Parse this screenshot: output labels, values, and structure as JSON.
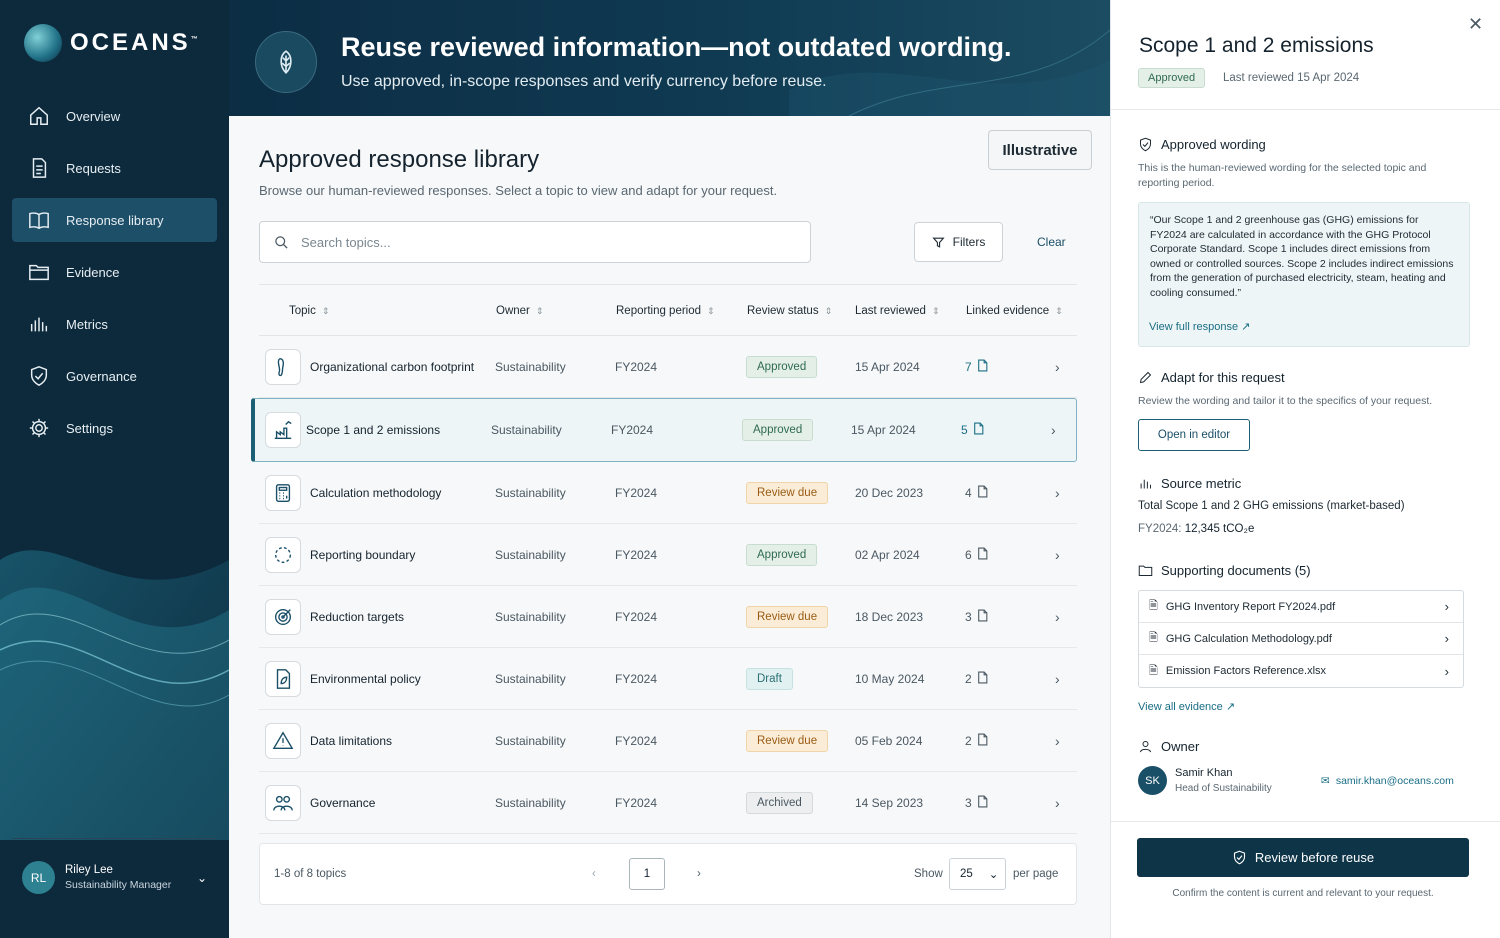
{
  "brand": {
    "name": "OCEANS",
    "tm": "™"
  },
  "nav": [
    {
      "label": "Overview",
      "icon": "home-icon",
      "active": false
    },
    {
      "label": "Requests",
      "icon": "document-icon",
      "active": false
    },
    {
      "label": "Response library",
      "icon": "book-icon",
      "active": true
    },
    {
      "label": "Evidence",
      "icon": "folder-icon",
      "active": false
    },
    {
      "label": "Metrics",
      "icon": "bar-chart-icon",
      "active": false
    },
    {
      "label": "Governance",
      "icon": "shield-icon",
      "active": false
    },
    {
      "label": "Settings",
      "icon": "gear-icon",
      "active": false
    }
  ],
  "user": {
    "initials": "RL",
    "name": "Riley Lee",
    "role": "Sustainability Manager"
  },
  "banner": {
    "title": "Reuse reviewed information—not outdated wording.",
    "subtitle": "Use approved, in-scope responses and verify currency before reuse."
  },
  "main": {
    "title": "Approved response library",
    "subtitle": "Browse our human-reviewed responses. Select a topic to view and adapt for your request.",
    "illustrative": "Illustrative",
    "search_placeholder": "Search topics...",
    "filters": "Filters",
    "clear": "Clear"
  },
  "columns": [
    "Topic",
    "Owner",
    "Reporting period",
    "Review status",
    "Last reviewed",
    "Linked evidence"
  ],
  "rows": [
    {
      "topic": "Organizational carbon footprint",
      "icon": "footprint-icon",
      "owner": "Sustainability",
      "period": "FY2024",
      "status": "Approved",
      "status_type": "approved",
      "date": "15 Apr 2024",
      "linked": "7",
      "selected": false
    },
    {
      "topic": "Scope 1 and 2 emissions",
      "icon": "factory-chart-icon",
      "owner": "Sustainability",
      "period": "FY2024",
      "status": "Approved",
      "status_type": "approved",
      "date": "15 Apr 2024",
      "linked": "5",
      "selected": true
    },
    {
      "topic": "Calculation methodology",
      "icon": "calculator-icon",
      "owner": "Sustainability",
      "period": "FY2024",
      "status": "Review due",
      "status_type": "review",
      "date": "20 Dec 2023",
      "linked": "4",
      "selected": false
    },
    {
      "topic": "Reporting boundary",
      "icon": "dashed-circle-icon",
      "owner": "Sustainability",
      "period": "FY2024",
      "status": "Approved",
      "status_type": "approved",
      "date": "02 Apr 2024",
      "linked": "6",
      "selected": false
    },
    {
      "topic": "Reduction targets",
      "icon": "target-icon",
      "owner": "Sustainability",
      "period": "FY2024",
      "status": "Review due",
      "status_type": "review",
      "date": "18 Dec 2023",
      "linked": "3",
      "selected": false
    },
    {
      "topic": "Environmental policy",
      "icon": "policy-leaf-icon",
      "owner": "Sustainability",
      "period": "FY2024",
      "status": "Draft",
      "status_type": "draft",
      "date": "10 May 2024",
      "linked": "2",
      "selected": false
    },
    {
      "topic": "Data limitations",
      "icon": "warning-icon",
      "owner": "Sustainability",
      "period": "FY2024",
      "status": "Review due",
      "status_type": "review",
      "date": "05 Feb 2024",
      "linked": "2",
      "selected": false
    },
    {
      "topic": "Governance",
      "icon": "people-icon",
      "owner": "Sustainability",
      "period": "FY2024",
      "status": "Archived",
      "status_type": "archived",
      "date": "14 Sep 2023",
      "linked": "3",
      "selected": false
    }
  ],
  "pager": {
    "count": "1-8 of 8 topics",
    "page": "1",
    "show": "Show",
    "per_page_value": "25",
    "per_page": "per page"
  },
  "panel": {
    "title": "Scope 1 and 2 emissions",
    "badge": "Approved",
    "last_reviewed": "Last reviewed 15 Apr 2024",
    "approved_heading": "Approved wording",
    "approved_desc": "This is the human-reviewed wording for the selected topic and reporting period.",
    "quote": "“Our Scope 1 and 2 greenhouse gas (GHG) emissions for FY2024 are calculated in accordance with the GHG Protocol Corporate Standard. Scope 1 includes direct emissions from owned or controlled sources. Scope 2 includes indirect emissions from the generation of purchased electricity, steam, heating and cooling consumed.”",
    "view_full": "View full response",
    "adapt_heading": "Adapt for this request",
    "adapt_desc": "Review the wording and tailor it to the specifics of your request.",
    "open_editor": "Open in editor",
    "source_heading": "Source metric",
    "metric_name": "Total Scope 1 and 2 GHG emissions (market-based)",
    "metric_label": "FY2024:",
    "metric_value": "12,345 tCO₂e",
    "docs_heading": "Supporting documents (5)",
    "docs": [
      "GHG Inventory Report FY2024.pdf",
      "GHG Calculation Methodology.pdf",
      "Emission Factors Reference.xlsx"
    ],
    "view_all": "View all evidence",
    "owner_heading": "Owner",
    "owner_initials": "SK",
    "owner_name": "Samir Khan",
    "owner_role": "Head of Sustainability",
    "owner_email": "samir.khan@oceans.com",
    "review_button": "Review before reuse",
    "review_note": "Confirm the content is current and relevant to your request."
  },
  "colors": {
    "sidebar": "#0d2a3d",
    "accent": "#1a5f73",
    "button": "#0e3448"
  }
}
